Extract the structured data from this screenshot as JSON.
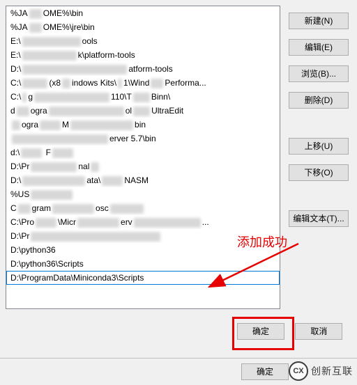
{
  "list": {
    "items": [
      "%JA███OME%\\bin",
      "%JA███OME%\\jre\\bin",
      "E:\\██████████████ools",
      "E:\\█████████████k\\platform-tools",
      "D:\\█████████████████████████atform-tools",
      "C:\\██████(x8██indows Kits\\█1\\Wind███Performa...",
      "C:\\█g██████████████████110\\T████Binn\\",
      "d███ogra██████████████████ol████UltraEdit",
      "██ogra█████M███████████████bin",
      "███████████████████████erver 5.7\\bin",
      "d:\\█████ F█████",
      "D:\\Pr███████████nal██",
      "D:\\███████████████ata\\█████NASM",
      "%US██████████",
      "C███gram██████████osc████████",
      "C:\\Pro█████\\Micr██████████erv████████████████...",
      "D:\\Pr███████████████████████████████",
      "D:\\python36",
      "D:\\python36\\Scripts",
      "D:\\ProgramData\\Miniconda3\\Scripts"
    ],
    "selected_index": 19
  },
  "buttons": {
    "new": "新建(N)",
    "edit": "编辑(E)",
    "browse": "浏览(B)...",
    "delete": "删除(D)",
    "move_up": "上移(U)",
    "move_down": "下移(O)",
    "edit_text": "编辑文本(T)...",
    "ok": "确定",
    "cancel": "取消",
    "footer_ok": "确定"
  },
  "annotation": {
    "label": "添加成功"
  },
  "watermark": {
    "badge": "CX",
    "text": "创新互联"
  }
}
